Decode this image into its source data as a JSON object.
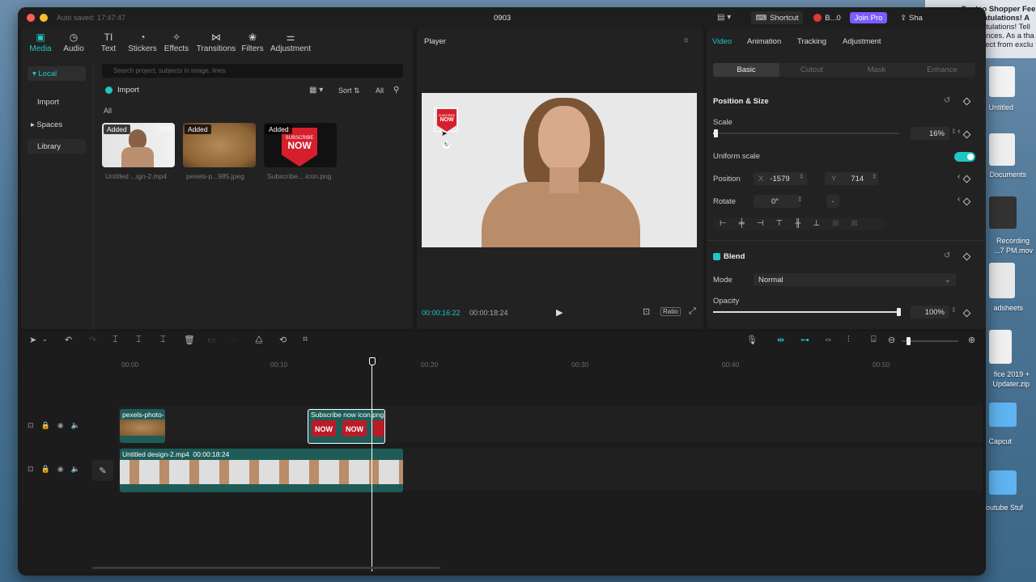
{
  "desktop": {
    "labels": [
      "Untitled",
      "Documents",
      "Recording",
      "...7 PM.mov",
      "adsheets",
      "fice 2019 +",
      "Updater.zip",
      "Capcut",
      "Youtube Stuf"
    ]
  },
  "notification": {
    "title": "Costco Shopper Fee",
    "line1": "Congratulations! A",
    "line2": "Congratulations! Tell",
    "line3": "experiences. As a tha",
    "line4": "can select from exclu"
  },
  "window": {
    "autosave": "Auto saved: 17:47:47",
    "project_name": "0903",
    "shortcut_label": "Shortcut",
    "user_label": "B...0",
    "join_pro": "Join Pro",
    "share_label": "Sha"
  },
  "toolbar": {
    "items": [
      {
        "label": "Media",
        "icon": "media-icon"
      },
      {
        "label": "Audio",
        "icon": "audio-icon"
      },
      {
        "label": "Text",
        "icon": "text-icon"
      },
      {
        "label": "Stickers",
        "icon": "stickers-icon"
      },
      {
        "label": "Effects",
        "icon": "effects-icon"
      },
      {
        "label": "Transitions",
        "icon": "transitions-icon"
      },
      {
        "label": "Filters",
        "icon": "filters-icon"
      },
      {
        "label": "Adjustment",
        "icon": "adjustment-icon"
      }
    ]
  },
  "media_sidebar": {
    "items": [
      "▾ Local",
      "Import",
      "▸ Spaces",
      "Library"
    ]
  },
  "media": {
    "search_placeholder": "Search project, subjects in image, lines",
    "import_label": "Import",
    "sort_label": "Sort",
    "all_filter": "All",
    "section_label": "All",
    "items": [
      {
        "tag": "Added",
        "caption": "Untitled ...ign-2.mp4",
        "duration": "00:0"
      },
      {
        "tag": "Added",
        "caption": "pexels-p...985.jpeg"
      },
      {
        "tag": "Added",
        "caption": "Subscribe... icon.png"
      }
    ]
  },
  "player": {
    "title": "Player",
    "current_time": "00:00:16:22",
    "total_time": "00:00:18:24",
    "ratio_label": "Ratio",
    "sticker_line1": "SUBSCRIBE",
    "sticker_line2": "NOW"
  },
  "inspector": {
    "tabs": [
      "Video",
      "Animation",
      "Tracking",
      "Adjustment"
    ],
    "subtabs": [
      "Basic",
      "Cutout",
      "Mask",
      "Enhance"
    ],
    "position_size_title": "Position & Size",
    "scale_label": "Scale",
    "scale_value": "16%",
    "scale_fraction": 0.16,
    "uniform_scale_label": "Uniform scale",
    "position_label": "Position",
    "x_label": "X",
    "x_value": "-1579",
    "y_label": "Y",
    "y_value": "714",
    "rotate_label": "Rotate",
    "rotate_value": "0°",
    "blend_title": "Blend",
    "mode_label": "Mode",
    "mode_value": "Normal",
    "opacity_label": "Opacity",
    "opacity_value": "100%",
    "opacity_fraction": 1.0
  },
  "timeline": {
    "ruler": [
      "00:00",
      "00:10",
      "00:20",
      "00:30",
      "00:40",
      "00:50"
    ],
    "clips": {
      "photo": "pexels-photo-",
      "sticker": "Subscribe now icon.png",
      "video_name": "Untitled design-2.mp4",
      "video_duration": "00:00:18:24"
    }
  },
  "colors": {
    "accent": "#20c5c5",
    "join_pro": "#7b5cff",
    "clip_teal": "#1f5c58"
  }
}
